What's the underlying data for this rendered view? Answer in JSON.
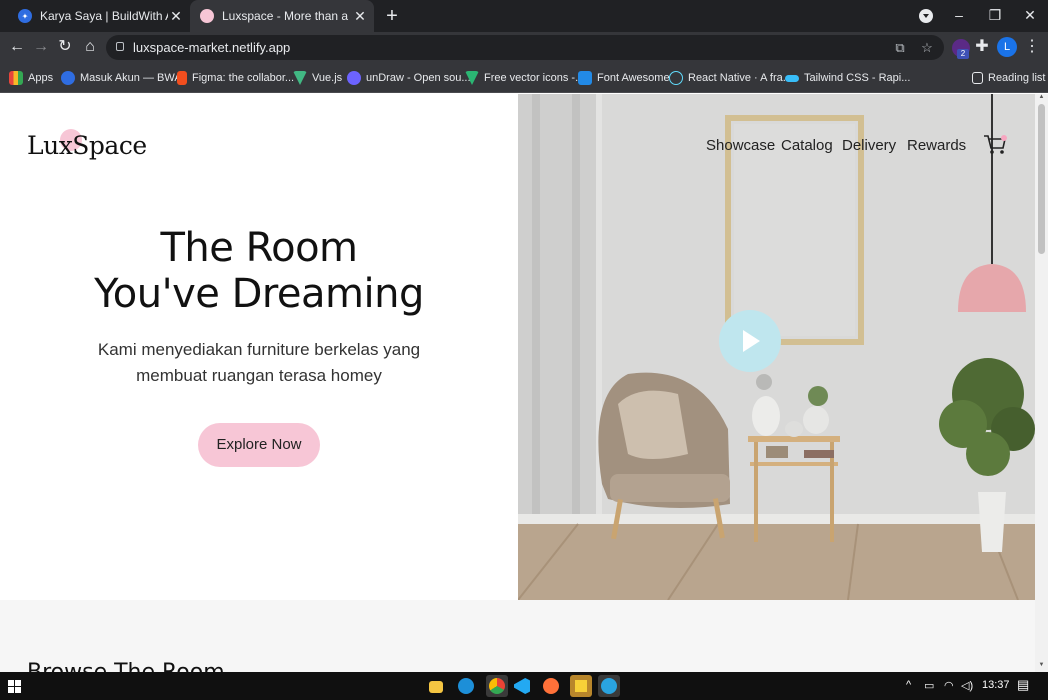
{
  "browser": {
    "tabs": [
      {
        "title": "Karya Saya | BuildWith Angga",
        "favicon": "bwa-icon"
      },
      {
        "title": "Luxspace - More than a Store",
        "favicon": "luxspace-icon"
      }
    ],
    "new_tab": "+",
    "url": "luxspace-market.netlify.app",
    "window_controls": {
      "minimize": "–",
      "maximize": "❐",
      "close": "✕"
    },
    "avatar_letter": "L",
    "extension_badge": "2",
    "bookmarks": [
      {
        "label": "Apps",
        "color": "#e8453c"
      },
      {
        "label": "Masuk Akun — BWA",
        "color": "#2f6de1"
      },
      {
        "label": "Figma: the collabor...",
        "color": "#f24e1e"
      },
      {
        "label": "Vue.js",
        "color": "#41b883"
      },
      {
        "label": "unDraw - Open sou...",
        "color": "#6c63ff"
      },
      {
        "label": "Free vector icons -...",
        "color": "#2bb673"
      },
      {
        "label": "Font Awesome",
        "color": "#228ae6"
      },
      {
        "label": "React Native · A fra...",
        "color": "#61dafb"
      },
      {
        "label": "Tailwind CSS - Rapi...",
        "color": "#38bdf8"
      }
    ],
    "reading_list": "Reading list"
  },
  "page": {
    "logo": "LuxSpace",
    "nav": [
      "Showcase",
      "Catalog",
      "Delivery",
      "Rewards"
    ],
    "headline_line1": "The Room",
    "headline_line2": "You've Dreaming",
    "sub_line1": "Kami menyediakan furniture berkelas yang",
    "sub_line2": "membuat ruangan terasa homey",
    "cta": "Explore Now",
    "next_section": "Browse The Room",
    "accent": "#f7c6d6",
    "play_color": "#bfe6ee"
  },
  "taskbar": {
    "time": "13:37"
  }
}
